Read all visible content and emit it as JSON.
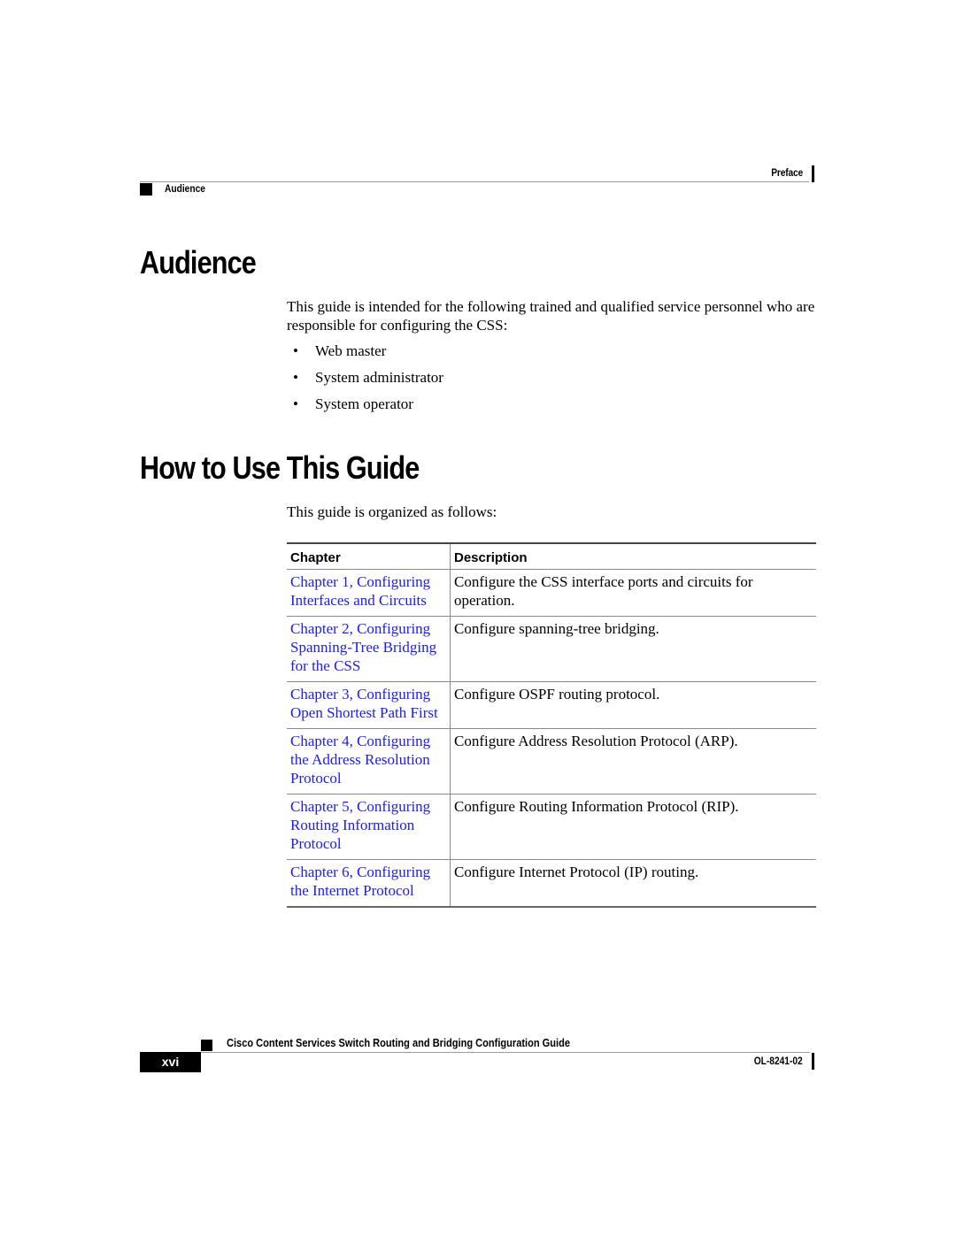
{
  "header": {
    "chapter_label": "Preface",
    "section_label": "Audience"
  },
  "sections": {
    "audience": {
      "title": "Audience",
      "intro": "This guide is intended for the following trained and qualified service personnel who are responsible for configuring the CSS:",
      "bullet_glyph": "•",
      "bullets": [
        "Web master",
        "System administrator",
        "System operator"
      ]
    },
    "how_to_use": {
      "title": "How to Use This Guide",
      "intro": "This guide is organized as follows:",
      "table": {
        "headers": [
          "Chapter",
          "Description"
        ],
        "rows": [
          {
            "chapter": "Chapter 1, Configuring Interfaces and Circuits",
            "description": "Configure the CSS interface ports and circuits for operation."
          },
          {
            "chapter": "Chapter 2, Configuring Spanning-Tree Bridging for the CSS",
            "description": "Configure spanning-tree bridging."
          },
          {
            "chapter": "Chapter 3, Configuring Open Shortest Path First",
            "description": "Configure OSPF routing protocol."
          },
          {
            "chapter": "Chapter 4, Configuring the Address Resolution Protocol",
            "description": "Configure Address Resolution Protocol (ARP)."
          },
          {
            "chapter": "Chapter 5, Configuring Routing Information Protocol",
            "description": "Configure Routing Information Protocol (RIP)."
          },
          {
            "chapter": "Chapter 6, Configuring the Internet Protocol",
            "description": "Configure Internet Protocol (IP) routing."
          }
        ]
      }
    }
  },
  "footer": {
    "guide_title": "Cisco Content Services Switch Routing and Bridging Configuration Guide",
    "page_number": "xvi",
    "doc_number": "OL-8241-02"
  },
  "colors": {
    "link": "#1a1aff",
    "text": "#000000"
  }
}
